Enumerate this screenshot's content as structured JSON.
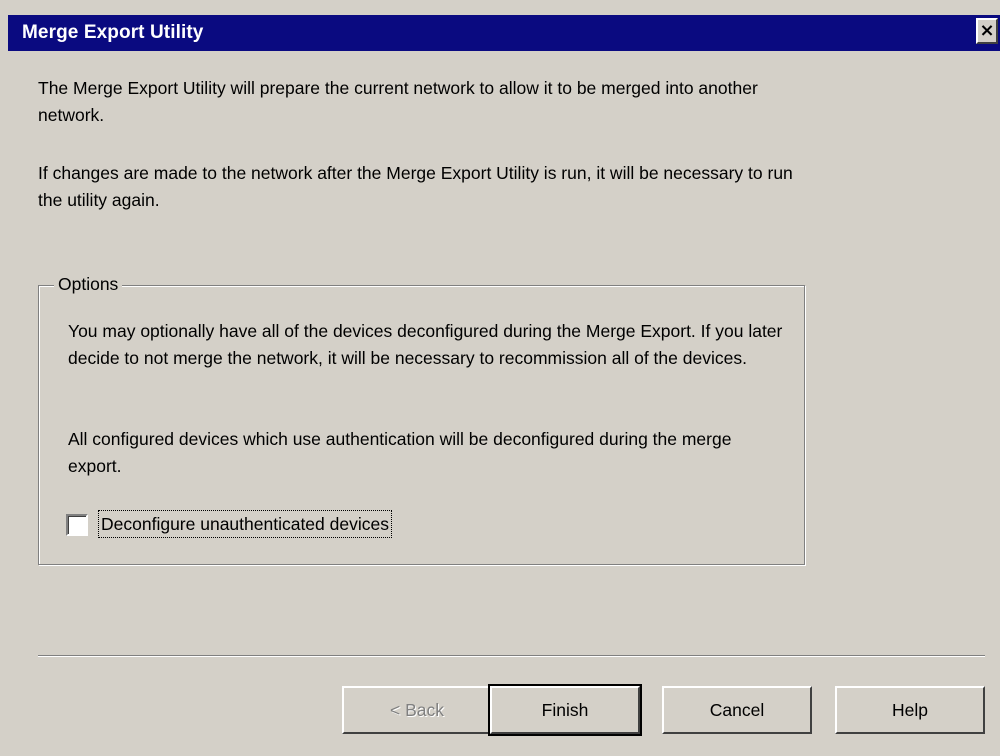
{
  "window": {
    "title": "Merge Export Utility",
    "close_glyph": "×"
  },
  "intro": {
    "paragraph1": "The Merge Export Utility will prepare the current network to allow it to be merged into another network.",
    "paragraph2": "If changes are made to the network after the Merge Export Utility is run, it will be necessary to run the utility again."
  },
  "options": {
    "label": "Options",
    "text1": "You may optionally have all of the devices deconfigured during the Merge Export. If you later decide to not merge the network, it will be necessary to recommission all of the devices.",
    "text2": "All configured devices which use authentication will be deconfigured during the merge export.",
    "checkbox_label": "Deconfigure unauthenticated devices",
    "checkbox_checked": false
  },
  "buttons": {
    "back": "< Back",
    "finish": "Finish",
    "cancel": "Cancel",
    "help": "Help"
  },
  "colors": {
    "face": "#d4d0c8",
    "titlebar": "#0a0a80",
    "disabled_text": "#808080"
  }
}
